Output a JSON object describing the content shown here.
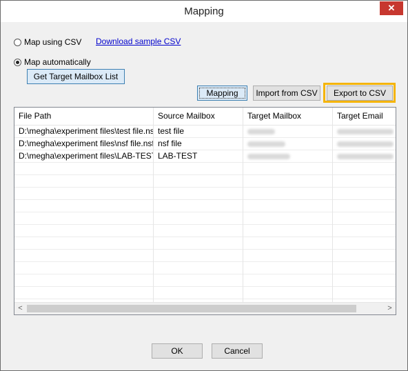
{
  "window": {
    "title": "Mapping",
    "close_glyph": "✕"
  },
  "options": {
    "csv_label": "Map using CSV",
    "download_link": "Download sample CSV",
    "auto_label": "Map automatically",
    "selected": "auto"
  },
  "buttons": {
    "get_target": "Get Target Mailbox List",
    "mapping": "Mapping",
    "import_csv": "Import from CSV",
    "export_csv": "Export to CSV",
    "ok": "OK",
    "cancel": "Cancel"
  },
  "grid": {
    "columns": [
      "File Path",
      "Source Mailbox",
      "Target Mailbox",
      "Target Email"
    ],
    "rows": [
      {
        "file_path": "D:\\megha\\experiment files\\test file.nsf",
        "source_mailbox": "test file"
      },
      {
        "file_path": "D:\\megha\\experiment files\\nsf file.nsf",
        "source_mailbox": "nsf file"
      },
      {
        "file_path": "D:\\megha\\experiment files\\LAB-TEST....",
        "source_mailbox": "LAB-TEST"
      }
    ],
    "scroll_left": "<",
    "scroll_right": ">"
  },
  "colors": {
    "highlight": "#f5b400",
    "link": "#0000cc",
    "close": "#c7372f"
  }
}
